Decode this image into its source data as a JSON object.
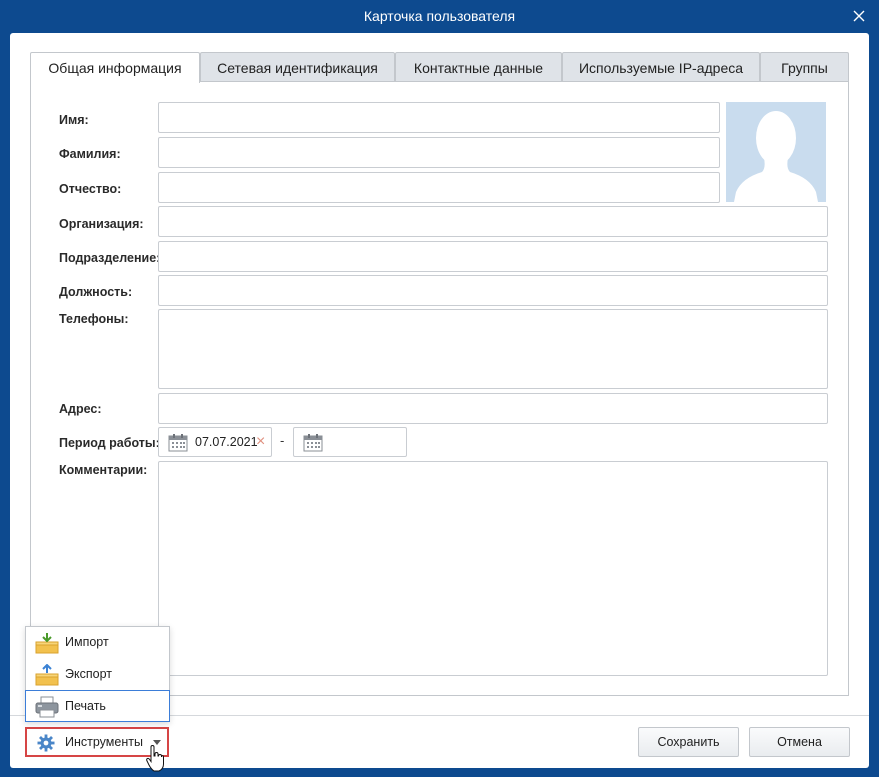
{
  "window": {
    "title": "Карточка пользователя",
    "close_icon": "close-icon"
  },
  "tabs": [
    {
      "label": "Общая информация",
      "active": true
    },
    {
      "label": "Сетевая идентификация",
      "active": false
    },
    {
      "label": "Контактные данные",
      "active": false
    },
    {
      "label": "Используемые IP-адреса",
      "active": false
    },
    {
      "label": "Группы",
      "active": false
    }
  ],
  "form": {
    "first_name": {
      "label": "Имя:",
      "value": ""
    },
    "last_name": {
      "label": "Фамилия:",
      "value": ""
    },
    "middle_name": {
      "label": "Отчество:",
      "value": ""
    },
    "organization": {
      "label": "Организация:",
      "value": ""
    },
    "department": {
      "label": "Подразделение:",
      "value": ""
    },
    "position": {
      "label": "Должность:",
      "value": ""
    },
    "phones": {
      "label": "Телефоны:",
      "value": ""
    },
    "address": {
      "label": "Адрес:",
      "value": ""
    },
    "work_period": {
      "label": "Период работы:",
      "from": "07.07.2021",
      "separator": "-",
      "to": ""
    },
    "comments": {
      "label": "Комментарии:",
      "value": ""
    }
  },
  "menu": {
    "items": [
      {
        "label": "Импорт",
        "icon": "import-icon"
      },
      {
        "label": "Экспорт",
        "icon": "export-icon"
      },
      {
        "label": "Печать",
        "icon": "printer-icon",
        "selected": true
      }
    ]
  },
  "footer": {
    "tools_label": "Инструменты",
    "save_label": "Сохранить",
    "cancel_label": "Отмена"
  },
  "colors": {
    "frame": "#0d4a8f",
    "tab_inactive": "#dfe3e8",
    "photo_bg": "#c9dcee",
    "highlight_border": "#d64545",
    "selection_border": "#3b7dd8"
  }
}
